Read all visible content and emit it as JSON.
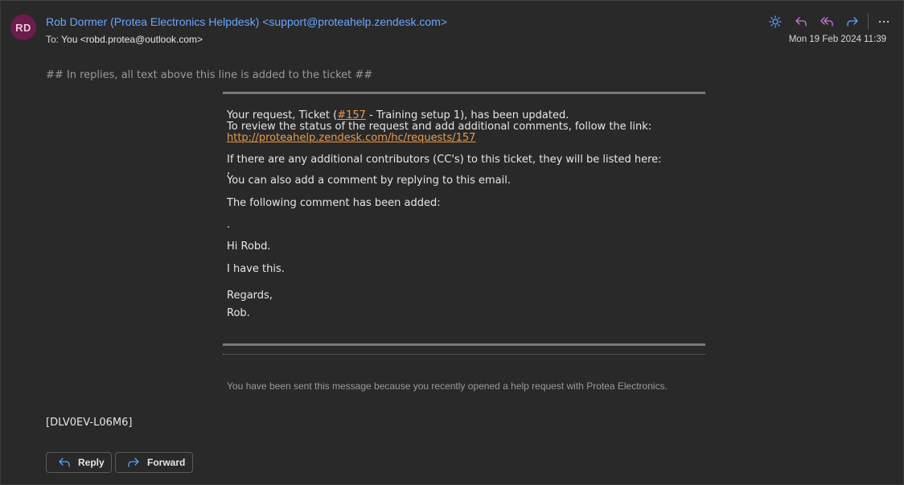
{
  "header": {
    "avatar_initials": "RD",
    "avatar_color": "#6b1d4b",
    "from": "Rob Dormer (Protea Electronics Helpdesk) <support@proteahelp.zendesk.com>",
    "to_prefix": "To:",
    "to_value": "You <robd.protea@outlook.com>",
    "date": "Mon 19 Feb 2024 11:39",
    "toolbar": [
      {
        "name": "sun-icon"
      },
      {
        "name": "reply-icon"
      },
      {
        "name": "reply-all-icon"
      },
      {
        "name": "forward-icon"
      },
      {
        "name": "more-icon"
      }
    ]
  },
  "message": {
    "reply_line": "## In replies, all text above this line is added to the ticket ##",
    "update_pre": "Your request, Ticket (",
    "ticket_link": "#157",
    "update_post": " - Training setup 1), has been updated.",
    "review_text": "To review the status of the request and add additional comments, follow the link:",
    "request_url": "http://proteahelp.zendesk.com/hc/requests/157",
    "cc_text": "If there are any additional contributors (CC's) to this ticket, they will be listed here:",
    "cc_list": ",",
    "reply_hint": "You can also add a comment by replying to this email.",
    "comment_intro": "The following comment has been added:",
    "dot": ".",
    "greeting": "Hi Robd.",
    "body": "I have this.",
    "signoff": "Regards,",
    "signature": "Rob.",
    "footer_note": "You have been sent this message because you recently opened a help request with Protea Electronics.",
    "ticket_code": "[DLV0EV-L06M6]"
  },
  "actions": {
    "reply_label": "Reply",
    "forward_label": "Forward"
  },
  "colors": {
    "link": "#69a6ff",
    "body_link": "#e89b4d",
    "background": "#292929"
  }
}
